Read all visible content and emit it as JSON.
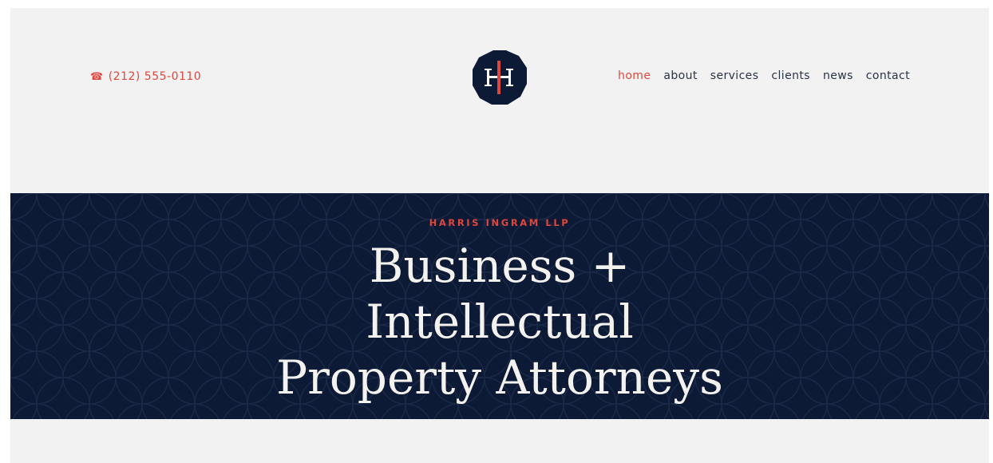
{
  "header": {
    "phone_icon": "phone-icon",
    "phone": "(212) 555-0110",
    "logo": {
      "icon": "hi-monogram-logo",
      "letters": "HI"
    },
    "nav": [
      {
        "label": "home",
        "active": true
      },
      {
        "label": "about",
        "active": false
      },
      {
        "label": "services",
        "active": false
      },
      {
        "label": "clients",
        "active": false
      },
      {
        "label": "news",
        "active": false
      },
      {
        "label": "contact",
        "active": false
      }
    ]
  },
  "hero": {
    "eyebrow": "HARRIS INGRAM LLP",
    "headline": [
      "Business +",
      "Intellectual",
      "Property Attorneys"
    ]
  },
  "colors": {
    "accent": "#e0473c",
    "navy": "#0c1a35",
    "nav_text": "#2a3446",
    "page_bg": "#f2f2f2",
    "headline_text": "#f4f2ee"
  }
}
